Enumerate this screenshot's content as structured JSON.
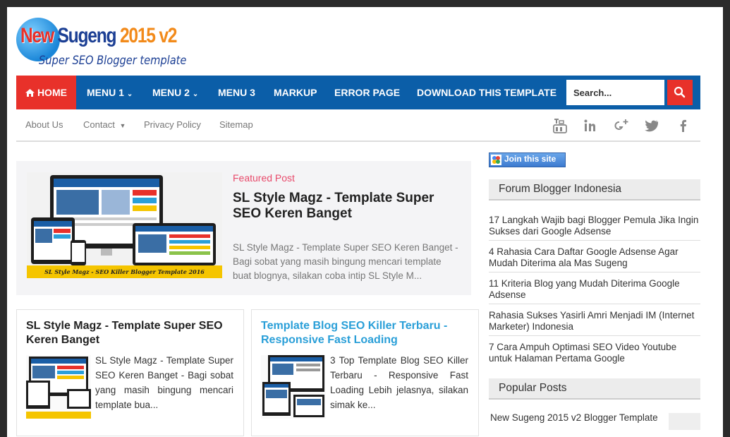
{
  "logo": {
    "part1": "New",
    "part2": "Sugeng",
    "part3": "2015 v2",
    "tagline": "Super SEO Blogger template"
  },
  "nav": {
    "home": "HOME",
    "items": [
      "MENU 1",
      "MENU 2",
      "MENU 3",
      "MARKUP",
      "ERROR PAGE",
      "DOWNLOAD THIS TEMPLATE"
    ],
    "search_placeholder": "Search..."
  },
  "subnav": {
    "links": [
      "About Us",
      "Contact",
      "Privacy Policy",
      "Sitemap"
    ],
    "social": [
      "youtube-icon",
      "linkedin-icon",
      "google-plus-icon",
      "twitter-icon",
      "facebook-icon"
    ]
  },
  "featured": {
    "label": "Featured Post",
    "title": "SL Style Magz - Template Super SEO Keren Banget",
    "description": "SL Style Magz - Template Super SEO Keren Banget - Bagi sobat yang masih bingung mencari template buat blognya, silakan coba intip SL Style M...",
    "image_caption": "SL Style Magz - SEO Killer Blogger Template 2016"
  },
  "posts": [
    {
      "title": "SL Style Magz - Template Super SEO Keren Banget",
      "description": "SL Style Magz - Template Super SEO Keren Banget - Bagi sobat yang masih bingung mencari template bua...",
      "thumb_caption": "SL Style Magz - SEO Killer Blogger Template 2016",
      "title_color": "#222222"
    },
    {
      "title": "Template Blog SEO Killer Terbaru - Responsive Fast Loading",
      "description": "3 Top Template Blog SEO Killer Terbaru - Responsive Fast Loading Lebih jelasnya, silakan simak ke...",
      "title_color": "#2a9fd8"
    }
  ],
  "sidebar": {
    "join_button": "Join this site",
    "forum_title": "Forum Blogger Indonesia",
    "forum_items": [
      "17 Langkah Wajib bagi Blogger Pemula Jika Ingin Sukses dari Google Adsense",
      "4 Rahasia Cara Daftar Google Adsense Agar Mudah Diterima ala Mas Sugeng",
      "11 Kriteria Blog yang Mudah Diterima Google Adsense",
      "Rahasia Sukses Yasirli Amri Menjadi IM (Internet Marketer) Indonesia",
      "7 Cara Ampuh Optimasi SEO Video Youtube untuk Halaman Pertama Google"
    ],
    "popular_title": "Popular Posts",
    "popular_items": [
      "New Sugeng 2015 v2 Blogger Template"
    ]
  },
  "colors": {
    "nav_blue": "#0b5ea8",
    "accent_red": "#e8312a",
    "featured_label": "#e84a6b",
    "link_blue": "#2a9fd8"
  }
}
